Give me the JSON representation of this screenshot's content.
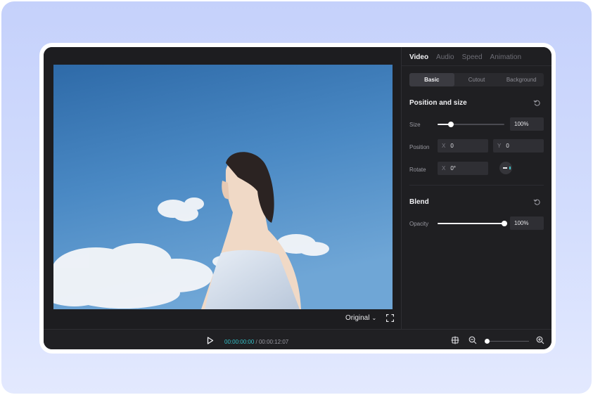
{
  "preview": {
    "ratio_label": "Original",
    "chevron": "chevron-down-icon"
  },
  "panel": {
    "tabs": [
      {
        "label": "Video",
        "active": true
      },
      {
        "label": "Audio",
        "active": false
      },
      {
        "label": "Speed",
        "active": false
      },
      {
        "label": "Animation",
        "active": false
      }
    ],
    "subtabs": [
      {
        "label": "Basic",
        "active": true
      },
      {
        "label": "Cutout",
        "active": false
      },
      {
        "label": "Background",
        "active": false
      }
    ],
    "position_section": {
      "title": "Position and size",
      "size_label": "Size",
      "size_value": "100%",
      "size_slider_level": 0.2,
      "position_label": "Position",
      "x_axis": "X",
      "x_value": "0",
      "y_axis": "Y",
      "y_value": "0",
      "rotate_label": "Rotate",
      "rotate_axis": "X",
      "rotate_value": "0°"
    },
    "blend_section": {
      "title": "Blend",
      "opacity_label": "Opacity",
      "opacity_value": "100%",
      "opacity_slider_level": 1.0
    }
  },
  "playback": {
    "current_time": "00:00:00:00",
    "separator": "/",
    "total_time": "00:00:12:07",
    "zoom_level": 0.05
  },
  "colors": {
    "accent_time": "#35c1c9",
    "panel_bg": "#1f1f22",
    "backdrop": "#c5d1fb"
  }
}
